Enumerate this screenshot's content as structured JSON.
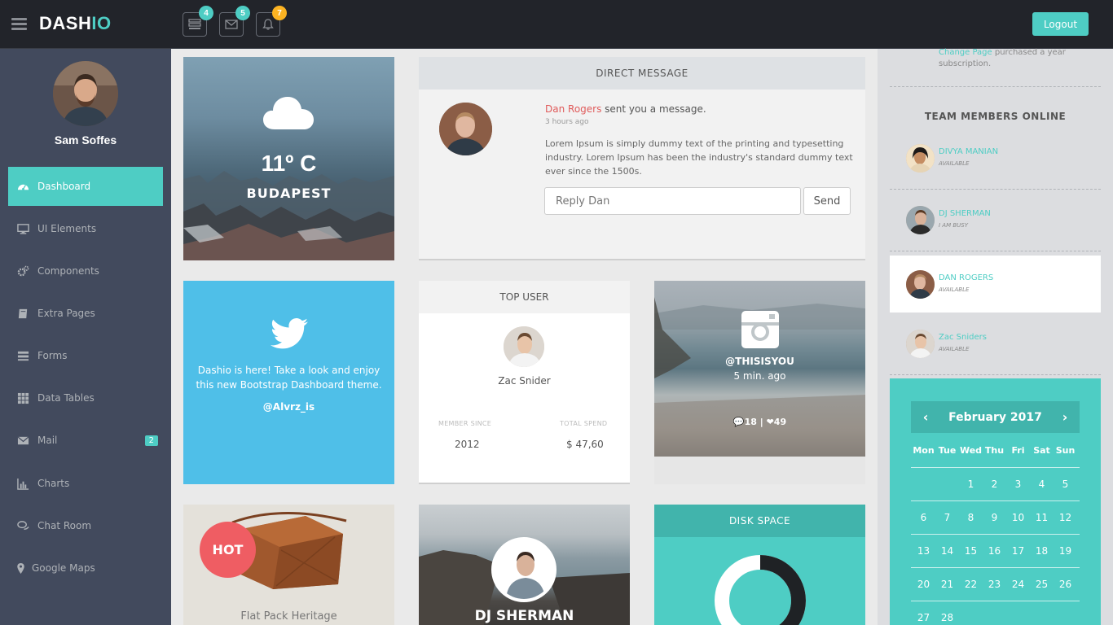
{
  "header": {
    "logo_part1": "DASH",
    "logo_part2": "IO",
    "notifications": [
      {
        "icon": "tasks-icon",
        "count": "4",
        "color": "#4ecdc4"
      },
      {
        "icon": "envelope-icon",
        "count": "5",
        "color": "#4ecdc4"
      },
      {
        "icon": "bell-icon",
        "count": "7",
        "color": "#fcb322"
      }
    ],
    "logout_label": "Logout"
  },
  "sidebar": {
    "username": "Sam Soffes",
    "items": [
      {
        "label": "Dashboard",
        "icon": "dashboard-icon",
        "active": true
      },
      {
        "label": "UI Elements",
        "icon": "desktop-icon"
      },
      {
        "label": "Components",
        "icon": "cogs-icon"
      },
      {
        "label": "Extra Pages",
        "icon": "book-icon"
      },
      {
        "label": "Forms",
        "icon": "tasks-icon"
      },
      {
        "label": "Data Tables",
        "icon": "th-icon"
      },
      {
        "label": "Mail",
        "icon": "envelope-icon",
        "badge": "2"
      },
      {
        "label": "Charts",
        "icon": "bar-chart-icon"
      },
      {
        "label": "Chat Room",
        "icon": "comments-icon"
      },
      {
        "label": "Google Maps",
        "icon": "map-marker-icon"
      }
    ]
  },
  "weather": {
    "temp": "11º C",
    "city": "BUDAPEST"
  },
  "direct_message": {
    "title": "DIRECT MESSAGE",
    "sender": "Dan Rogers",
    "action": " sent you a message.",
    "time": "3 hours ago",
    "text": "Lorem Ipsum is simply dummy text of the printing and typesetting industry. Lorem Ipsum has been the industry's standard dummy text ever since the 1500s.",
    "reply_placeholder": "Reply Dan",
    "send_label": "Send"
  },
  "twitter": {
    "text": "Dashio is here! Take a look and enjoy this new Bootstrap Dashboard theme.",
    "handle": "@Alvrz_is"
  },
  "top_user": {
    "title": "TOP USER",
    "name": "Zac Snider",
    "member_since_label": "MEMBER SINCE",
    "member_since": "2012",
    "total_spend_label": "TOTAL SPEND",
    "total_spend": "$ 47,60"
  },
  "instagram": {
    "handle": "@THISISYOU",
    "time": "5 min. ago",
    "comments": "18",
    "likes": "49"
  },
  "product": {
    "badge": "HOT",
    "name": "Flat Pack Heritage"
  },
  "dj_card": {
    "name": "DJ SHERMAN"
  },
  "disk": {
    "title": "DISK SPACE",
    "used_fraction": 0.5
  },
  "activity": {
    "link": "Change Page",
    "text": " purchased a year subscription."
  },
  "team": {
    "title": "TEAM MEMBERS ONLINE",
    "members": [
      {
        "name": "DIVYA MANIAN",
        "status": "AVAILABLE"
      },
      {
        "name": "DJ SHERMAN",
        "status": "I AM BUSY"
      },
      {
        "name": "DAN ROGERS",
        "status": "AVAILABLE",
        "highlighted": true
      },
      {
        "name": "Zac Sniders",
        "status": "AVAILABLE"
      }
    ]
  },
  "calendar": {
    "month": "February 2017",
    "prev": "‹",
    "next": "›",
    "days_of_week": [
      "Mon",
      "Tue",
      "Wed",
      "Thu",
      "Fri",
      "Sat",
      "Sun"
    ],
    "weeks": [
      [
        "",
        "",
        "1",
        "2",
        "3",
        "4",
        "5"
      ],
      [
        "6",
        "7",
        "8",
        "9",
        "10",
        "11",
        "12"
      ],
      [
        "13",
        "14",
        "15",
        "16",
        "17",
        "18",
        "19"
      ],
      [
        "20",
        "21",
        "22",
        "23",
        "24",
        "25",
        "26"
      ],
      [
        "27",
        "28",
        "",
        "",
        "",
        "",
        ""
      ]
    ]
  }
}
